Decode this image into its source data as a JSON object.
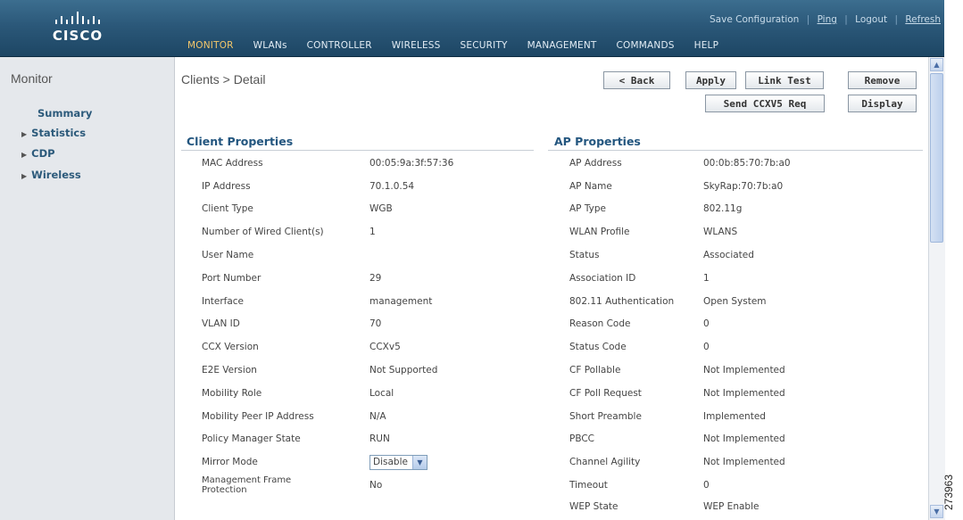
{
  "header": {
    "brand": "CISCO",
    "top_links": [
      "Save Configuration",
      "Ping",
      "Logout",
      "Refresh"
    ],
    "menu": [
      "MONITOR",
      "WLANs",
      "CONTROLLER",
      "WIRELESS",
      "SECURITY",
      "MANAGEMENT",
      "COMMANDS",
      "HELP"
    ]
  },
  "sidebar": {
    "title": "Monitor",
    "summary": "Summary",
    "items": [
      "Statistics",
      "CDP",
      "Wireless"
    ]
  },
  "page": {
    "breadcrumb": "Clients > Detail",
    "buttons": {
      "back": "< Back",
      "apply": "Apply",
      "link_test": "Link Test",
      "remove": "Remove",
      "send_ccxv5": "Send CCXV5 Req",
      "display": "Display"
    }
  },
  "client_properties": {
    "title": "Client Properties",
    "rows": [
      {
        "label": "MAC Address",
        "value": "00:05:9a:3f:57:36"
      },
      {
        "label": "IP Address",
        "value": "70.1.0.54"
      },
      {
        "label": "Client Type",
        "value": "WGB"
      },
      {
        "label": "Number of Wired Client(s)",
        "value": "1"
      },
      {
        "label": "User Name",
        "value": ""
      },
      {
        "label": "Port Number",
        "value": "29"
      },
      {
        "label": "Interface",
        "value": "management"
      },
      {
        "label": "VLAN ID",
        "value": "70"
      },
      {
        "label": "CCX Version",
        "value": "CCXv5"
      },
      {
        "label": "E2E Version",
        "value": "Not Supported"
      },
      {
        "label": "Mobility Role",
        "value": "Local"
      },
      {
        "label": "Mobility Peer IP Address",
        "value": "N/A"
      },
      {
        "label": "Policy Manager State",
        "value": "RUN"
      },
      {
        "label": "Mirror Mode",
        "value": "Disable"
      },
      {
        "label": "Management Frame Protection",
        "value": "No"
      }
    ]
  },
  "ap_properties": {
    "title": "AP Properties",
    "rows": [
      {
        "label": "AP Address",
        "value": "00:0b:85:70:7b:a0"
      },
      {
        "label": "AP Name",
        "value": "SkyRap:70:7b:a0"
      },
      {
        "label": "AP Type",
        "value": "802.11g"
      },
      {
        "label": "WLAN Profile",
        "value": "WLANS"
      },
      {
        "label": "Status",
        "value": "Associated"
      },
      {
        "label": "Association ID",
        "value": "1"
      },
      {
        "label": "802.11 Authentication",
        "value": "Open System"
      },
      {
        "label": "Reason Code",
        "value": "0"
      },
      {
        "label": "Status Code",
        "value": "0"
      },
      {
        "label": "CF Pollable",
        "value": "Not Implemented"
      },
      {
        "label": "CF Poll Request",
        "value": "Not Implemented"
      },
      {
        "label": "Short Preamble",
        "value": "Implemented"
      },
      {
        "label": "PBCC",
        "value": "Not Implemented"
      },
      {
        "label": "Channel Agility",
        "value": "Not Implemented"
      },
      {
        "label": "Timeout",
        "value": "0"
      },
      {
        "label": "WEP State",
        "value": "WEP Enable"
      }
    ]
  },
  "figure_id": "273963"
}
